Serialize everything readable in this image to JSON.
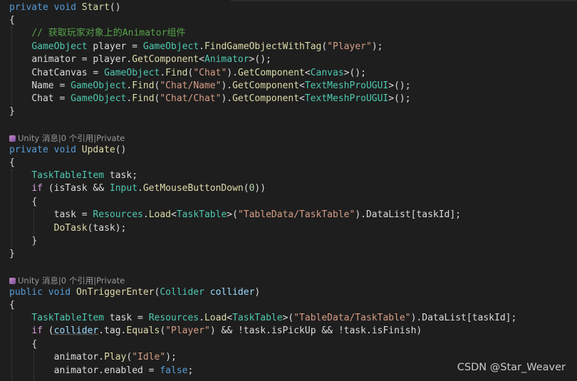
{
  "editor": {
    "lines": [
      [
        {
          "t": "private",
          "c": "kw"
        },
        {
          "t": " ",
          "c": "plain"
        },
        {
          "t": "void",
          "c": "kw"
        },
        {
          "t": " ",
          "c": "plain"
        },
        {
          "t": "Start",
          "c": "method"
        },
        {
          "t": "()",
          "c": "plain"
        }
      ],
      [
        {
          "t": "{",
          "c": "plain"
        }
      ],
      [
        {
          "t": "    ",
          "c": "plain"
        },
        {
          "t": "// 获取玩家对象上的Animator组件",
          "c": "cmt"
        }
      ],
      [
        {
          "t": "    ",
          "c": "plain"
        },
        {
          "t": "GameObject",
          "c": "type"
        },
        {
          "t": " player = ",
          "c": "plain"
        },
        {
          "t": "GameObject",
          "c": "type"
        },
        {
          "t": ".",
          "c": "plain"
        },
        {
          "t": "FindGameObjectWithTag",
          "c": "method"
        },
        {
          "t": "(",
          "c": "plain"
        },
        {
          "t": "\"Player\"",
          "c": "str"
        },
        {
          "t": ");",
          "c": "plain"
        }
      ],
      [
        {
          "t": "    ",
          "c": "plain"
        },
        {
          "t": "animator = player.",
          "c": "plain"
        },
        {
          "t": "GetComponent",
          "c": "method"
        },
        {
          "t": "<",
          "c": "plain"
        },
        {
          "t": "Animator",
          "c": "type"
        },
        {
          "t": ">();",
          "c": "plain"
        }
      ],
      [
        {
          "t": "    ",
          "c": "plain"
        },
        {
          "t": "ChatCanvas = ",
          "c": "plain"
        },
        {
          "t": "GameObject",
          "c": "type"
        },
        {
          "t": ".",
          "c": "plain"
        },
        {
          "t": "Find",
          "c": "method"
        },
        {
          "t": "(",
          "c": "plain"
        },
        {
          "t": "\"Chat\"",
          "c": "str"
        },
        {
          "t": ").",
          "c": "plain"
        },
        {
          "t": "GetComponent",
          "c": "method"
        },
        {
          "t": "<",
          "c": "plain"
        },
        {
          "t": "Canvas",
          "c": "type"
        },
        {
          "t": ">();",
          "c": "plain"
        }
      ],
      [
        {
          "t": "    ",
          "c": "plain"
        },
        {
          "t": "Name = ",
          "c": "plain"
        },
        {
          "t": "GameObject",
          "c": "type"
        },
        {
          "t": ".",
          "c": "plain"
        },
        {
          "t": "Find",
          "c": "method"
        },
        {
          "t": "(",
          "c": "plain"
        },
        {
          "t": "\"Chat/Name\"",
          "c": "str"
        },
        {
          "t": ").",
          "c": "plain"
        },
        {
          "t": "GetComponent",
          "c": "method"
        },
        {
          "t": "<",
          "c": "plain"
        },
        {
          "t": "TextMeshProUGUI",
          "c": "type"
        },
        {
          "t": ">();",
          "c": "plain"
        }
      ],
      [
        {
          "t": "    ",
          "c": "plain"
        },
        {
          "t": "Chat = ",
          "c": "plain"
        },
        {
          "t": "GameObject",
          "c": "type"
        },
        {
          "t": ".",
          "c": "plain"
        },
        {
          "t": "Find",
          "c": "method"
        },
        {
          "t": "(",
          "c": "plain"
        },
        {
          "t": "\"Chat/Chat\"",
          "c": "str"
        },
        {
          "t": ").",
          "c": "plain"
        },
        {
          "t": "GetComponent",
          "c": "method"
        },
        {
          "t": "<",
          "c": "plain"
        },
        {
          "t": "TextMeshProUGUI",
          "c": "type"
        },
        {
          "t": ">();",
          "c": "plain"
        }
      ],
      [
        {
          "t": "}",
          "c": "plain"
        }
      ],
      [],
      "ANN",
      [
        {
          "t": "private",
          "c": "kw"
        },
        {
          "t": " ",
          "c": "plain"
        },
        {
          "t": "void",
          "c": "kw"
        },
        {
          "t": " ",
          "c": "plain"
        },
        {
          "t": "Update",
          "c": "method"
        },
        {
          "t": "()",
          "c": "plain"
        }
      ],
      [
        {
          "t": "{",
          "c": "plain"
        }
      ],
      [
        {
          "t": "    ",
          "c": "plain"
        },
        {
          "t": "TaskTableItem",
          "c": "type"
        },
        {
          "t": " task;",
          "c": "plain"
        }
      ],
      [
        {
          "t": "    ",
          "c": "plain"
        },
        {
          "t": "if",
          "c": "ctl"
        },
        {
          "t": " (isTask && ",
          "c": "plain"
        },
        {
          "t": "Input",
          "c": "type"
        },
        {
          "t": ".",
          "c": "plain"
        },
        {
          "t": "GetMouseButtonDown",
          "c": "method"
        },
        {
          "t": "(",
          "c": "plain"
        },
        {
          "t": "0",
          "c": "num"
        },
        {
          "t": "))",
          "c": "plain"
        }
      ],
      [
        {
          "t": "    ",
          "c": "plain"
        },
        {
          "t": "{",
          "c": "plain"
        }
      ],
      [
        {
          "t": "        ",
          "c": "plain"
        },
        {
          "t": "task = ",
          "c": "plain"
        },
        {
          "t": "Resources",
          "c": "type"
        },
        {
          "t": ".",
          "c": "plain"
        },
        {
          "t": "Load",
          "c": "method"
        },
        {
          "t": "<",
          "c": "plain"
        },
        {
          "t": "TaskTable",
          "c": "type"
        },
        {
          "t": ">(",
          "c": "plain"
        },
        {
          "t": "\"TableData/TaskTable\"",
          "c": "str"
        },
        {
          "t": ").DataList[taskId];",
          "c": "plain"
        }
      ],
      [
        {
          "t": "        ",
          "c": "plain"
        },
        {
          "t": "DoTask",
          "c": "method"
        },
        {
          "t": "(task);",
          "c": "plain"
        }
      ],
      [
        {
          "t": "    ",
          "c": "plain"
        },
        {
          "t": "}",
          "c": "plain"
        }
      ],
      [
        {
          "t": "}",
          "c": "plain"
        }
      ],
      [],
      "ANN",
      [
        {
          "t": "public",
          "c": "kw"
        },
        {
          "t": " ",
          "c": "plain"
        },
        {
          "t": "void",
          "c": "kw"
        },
        {
          "t": " ",
          "c": "plain"
        },
        {
          "t": "OnTriggerEnter",
          "c": "method"
        },
        {
          "t": "(",
          "c": "plain"
        },
        {
          "t": "Collider",
          "c": "type"
        },
        {
          "t": " ",
          "c": "plain"
        },
        {
          "t": "collider",
          "c": "param"
        },
        {
          "t": ")",
          "c": "plain"
        }
      ],
      [
        {
          "t": "{",
          "c": "plain"
        }
      ],
      [
        {
          "t": "    ",
          "c": "plain"
        },
        {
          "t": "TaskTableItem",
          "c": "type"
        },
        {
          "t": " task = ",
          "c": "plain"
        },
        {
          "t": "Resources",
          "c": "type"
        },
        {
          "t": ".",
          "c": "plain"
        },
        {
          "t": "Load",
          "c": "method"
        },
        {
          "t": "<",
          "c": "plain"
        },
        {
          "t": "TaskTable",
          "c": "type"
        },
        {
          "t": ">(",
          "c": "plain"
        },
        {
          "t": "\"TableData/TaskTable\"",
          "c": "str"
        },
        {
          "t": ").DataList[taskId];",
          "c": "plain"
        }
      ],
      [
        {
          "t": "    ",
          "c": "plain"
        },
        {
          "t": "if",
          "c": "ctl"
        },
        {
          "t": " (",
          "c": "plain"
        },
        {
          "t": "collider",
          "c": "param",
          "sq": true
        },
        {
          "t": ".tag.",
          "c": "plain"
        },
        {
          "t": "Equals",
          "c": "method"
        },
        {
          "t": "(",
          "c": "plain"
        },
        {
          "t": "\"Player\"",
          "c": "str"
        },
        {
          "t": ") && !task.isPickUp && !task.isFinish)",
          "c": "plain"
        }
      ],
      [
        {
          "t": "    ",
          "c": "plain"
        },
        {
          "t": "{",
          "c": "plain"
        }
      ],
      [
        {
          "t": "        ",
          "c": "plain"
        },
        {
          "t": "animator.",
          "c": "plain"
        },
        {
          "t": "Play",
          "c": "method"
        },
        {
          "t": "(",
          "c": "plain"
        },
        {
          "t": "\"Idle\"",
          "c": "str"
        },
        {
          "t": ");",
          "c": "plain"
        }
      ],
      [
        {
          "t": "        ",
          "c": "plain"
        },
        {
          "t": "animator.enabled = ",
          "c": "plain"
        },
        {
          "t": "false",
          "c": "kw"
        },
        {
          "t": ";",
          "c": "plain"
        }
      ]
    ],
    "annotation_update": "Unity 消息|0 个引用|Private",
    "annotation_trigger": "Unity 消息|0 个引用|Private"
  },
  "watermark": "CSDN @Star_Weaver",
  "colors": {
    "background": "#1e1e1e",
    "keyword": "#569cd6",
    "control": "#d8a0df",
    "type": "#4ec9b0",
    "method": "#dcdcaa",
    "string": "#d69d85",
    "comment": "#57a64a",
    "number": "#b5cea8"
  }
}
